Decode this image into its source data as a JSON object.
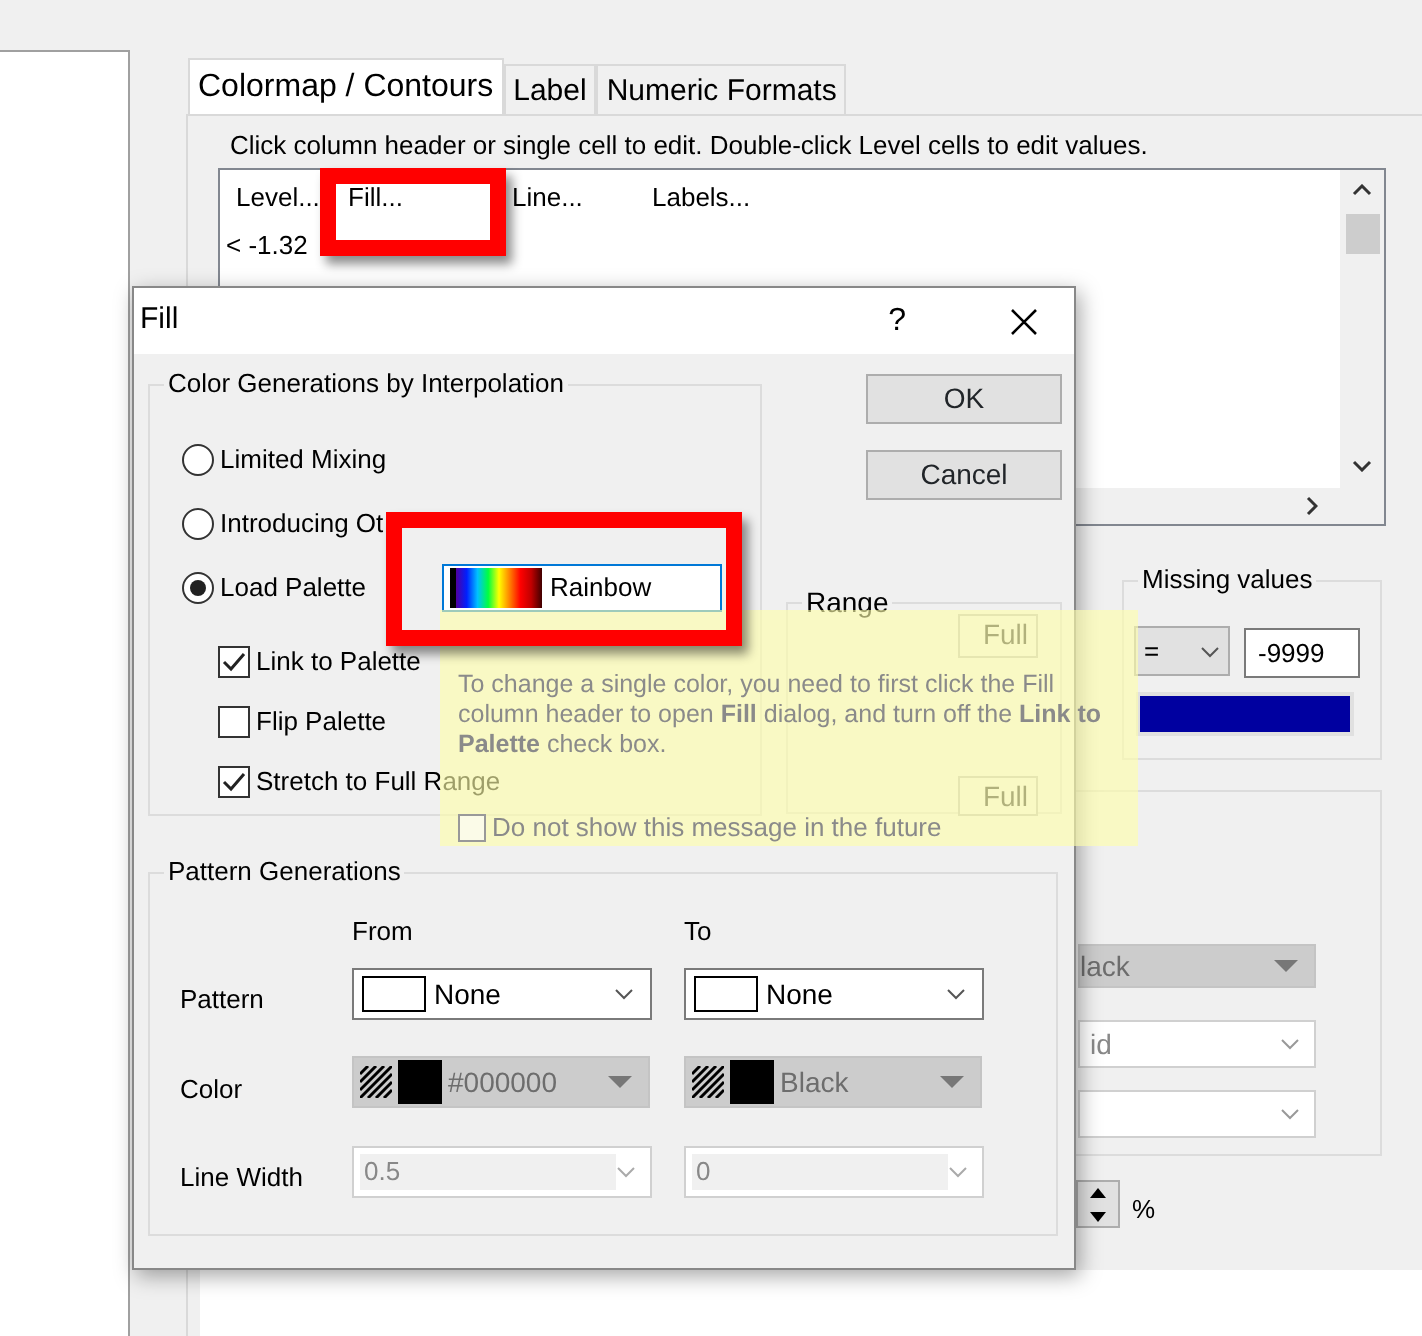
{
  "tabs": [
    {
      "label": "Colormap / Contours",
      "selected": true
    },
    {
      "label": "Label",
      "selected": false
    },
    {
      "label": "Numeric Formats",
      "selected": false
    }
  ],
  "instruction": "Click column header or single cell to edit. Double-click Level cells to edit values.",
  "level_table": {
    "columns": [
      "Level...",
      "Fill...",
      "Line...",
      "Labels..."
    ],
    "rows": [
      {
        "level": "< -1.32"
      }
    ]
  },
  "missing_values": {
    "title": "Missing values",
    "operator": "=",
    "value": "-9999"
  },
  "background_fields": [
    {
      "kind": "caret",
      "value": "lack"
    },
    {
      "kind": "chevron",
      "value": "id"
    },
    {
      "kind": "chevron"
    }
  ],
  "spinner_unit": "%",
  "dialog": {
    "title": "Fill",
    "help": "?",
    "interpolation": {
      "title": "Color Generations by Interpolation",
      "options": [
        {
          "label": "Limited Mixing",
          "selected": false
        },
        {
          "label": "Introducing Ot",
          "selected": false
        },
        {
          "label": "Load Palette",
          "selected": true
        }
      ],
      "palette": "Rainbow",
      "checks": [
        {
          "label": "Link to Palette",
          "checked": true
        },
        {
          "label": "Flip Palette",
          "checked": false
        },
        {
          "label": "Stretch to Full Range",
          "checked": true
        }
      ]
    },
    "buttons": [
      "OK",
      "Cancel"
    ],
    "range": {
      "title": "Range",
      "fields": [
        "Full",
        "Full"
      ]
    },
    "pattern": {
      "title": "Pattern Generations",
      "headers": [
        "From",
        "To"
      ],
      "rows": [
        {
          "label": "Pattern",
          "kind": "pattern",
          "from": "None",
          "to": "None"
        },
        {
          "label": "Color",
          "kind": "color",
          "from": "#000000",
          "to": "Black"
        },
        {
          "label": "Line Width",
          "kind": "width",
          "from": "0.5",
          "to": "0"
        }
      ]
    }
  },
  "tooltip": {
    "text": "To change a single color, you need to first click the Fill column header to open **Fill** dialog, and turn off the **Link to Palette** check box.",
    "dont_show": {
      "label": "Do not show this message in the future",
      "checked": false
    }
  }
}
